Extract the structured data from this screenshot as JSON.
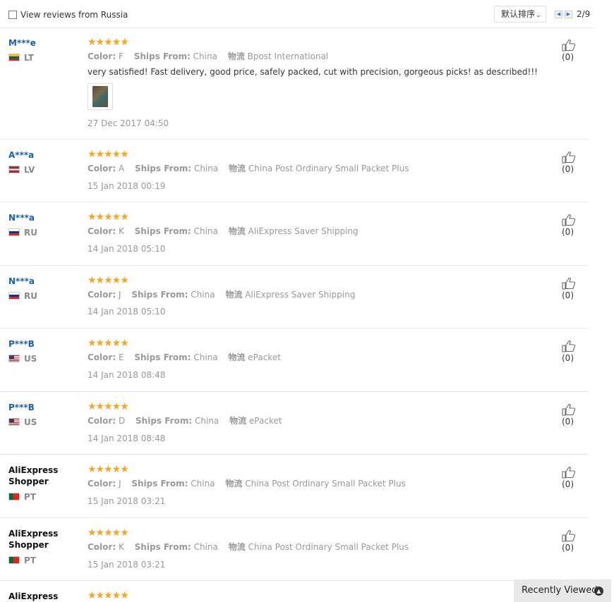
{
  "filter": {
    "label": "View reviews from Russia",
    "checked": false
  },
  "sort": {
    "label": "默认排序"
  },
  "pagination": {
    "info": "2/9",
    "prev_icon": "triangle-left-icon",
    "next_icon": "triangle-right-icon"
  },
  "labels": {
    "color": "Color:",
    "ships_from": "Ships From:",
    "logistics": "物流"
  },
  "reviews": [
    {
      "user": "M***e",
      "country": "LT",
      "stars": "★★★★★",
      "color": "F",
      "ships_from": "China",
      "logistics": "Bpost International",
      "text": "very satisfied! Fast delivery, good price, safely packed, cut with precision, gorgeous picks! as described!!!",
      "date": "27 Dec 2017 04:50",
      "likes": "(0)"
    },
    {
      "user": "A***a",
      "country": "LV",
      "stars": "★★★★★",
      "color": "A",
      "ships_from": "China",
      "logistics": "China Post Ordinary Small Packet Plus",
      "date": "15 Jan 2018 00:19",
      "likes": "(0)"
    },
    {
      "user": "N***a",
      "country": "RU",
      "stars": "★★★★★",
      "color": "K",
      "ships_from": "China",
      "logistics": "AliExpress Saver Shipping",
      "date": "14 Jan 2018 05:10",
      "likes": "(0)"
    },
    {
      "user": "N***a",
      "country": "RU",
      "stars": "★★★★★",
      "color": "J",
      "ships_from": "China",
      "logistics": "AliExpress Saver Shipping",
      "date": "14 Jan 2018 05:10",
      "likes": "(0)"
    },
    {
      "user": "P***B",
      "country": "US",
      "stars": "★★★★★",
      "color": "E",
      "ships_from": "China",
      "logistics": "ePacket",
      "date": "14 Jan 2018 08:48",
      "likes": "(0)"
    },
    {
      "user": "P***B",
      "country": "US",
      "stars": "★★★★★",
      "color": "D",
      "ships_from": "China",
      "logistics": "ePacket",
      "date": "14 Jan 2018 08:48",
      "likes": "(0)"
    },
    {
      "user_line1": "AliExpress",
      "user_line2": "Shopper",
      "country": "PT",
      "stars": "★★★★★",
      "color": "J",
      "ships_from": "China",
      "logistics": "China Post Ordinary Small Packet Plus",
      "date": "15 Jan 2018 03:21",
      "likes": "(0)"
    },
    {
      "user_line1": "AliExpress",
      "user_line2": "Shopper",
      "country": "PT",
      "stars": "★★★★★",
      "color": "K",
      "ships_from": "China",
      "logistics": "China Post Ordinary Small Packet Plus",
      "date": "15 Jan 2018 03:21",
      "likes": "(0)"
    },
    {
      "user_line1": "AliExpress",
      "stars": "★★★★★"
    }
  ],
  "recently_viewed": {
    "label": "Recently Viewed",
    "icon": "chevron-up-circle-icon"
  },
  "colors": {
    "link_blue": "#1a5fb4",
    "star_orange": "#f5a623",
    "muted_gray": "#999999"
  }
}
